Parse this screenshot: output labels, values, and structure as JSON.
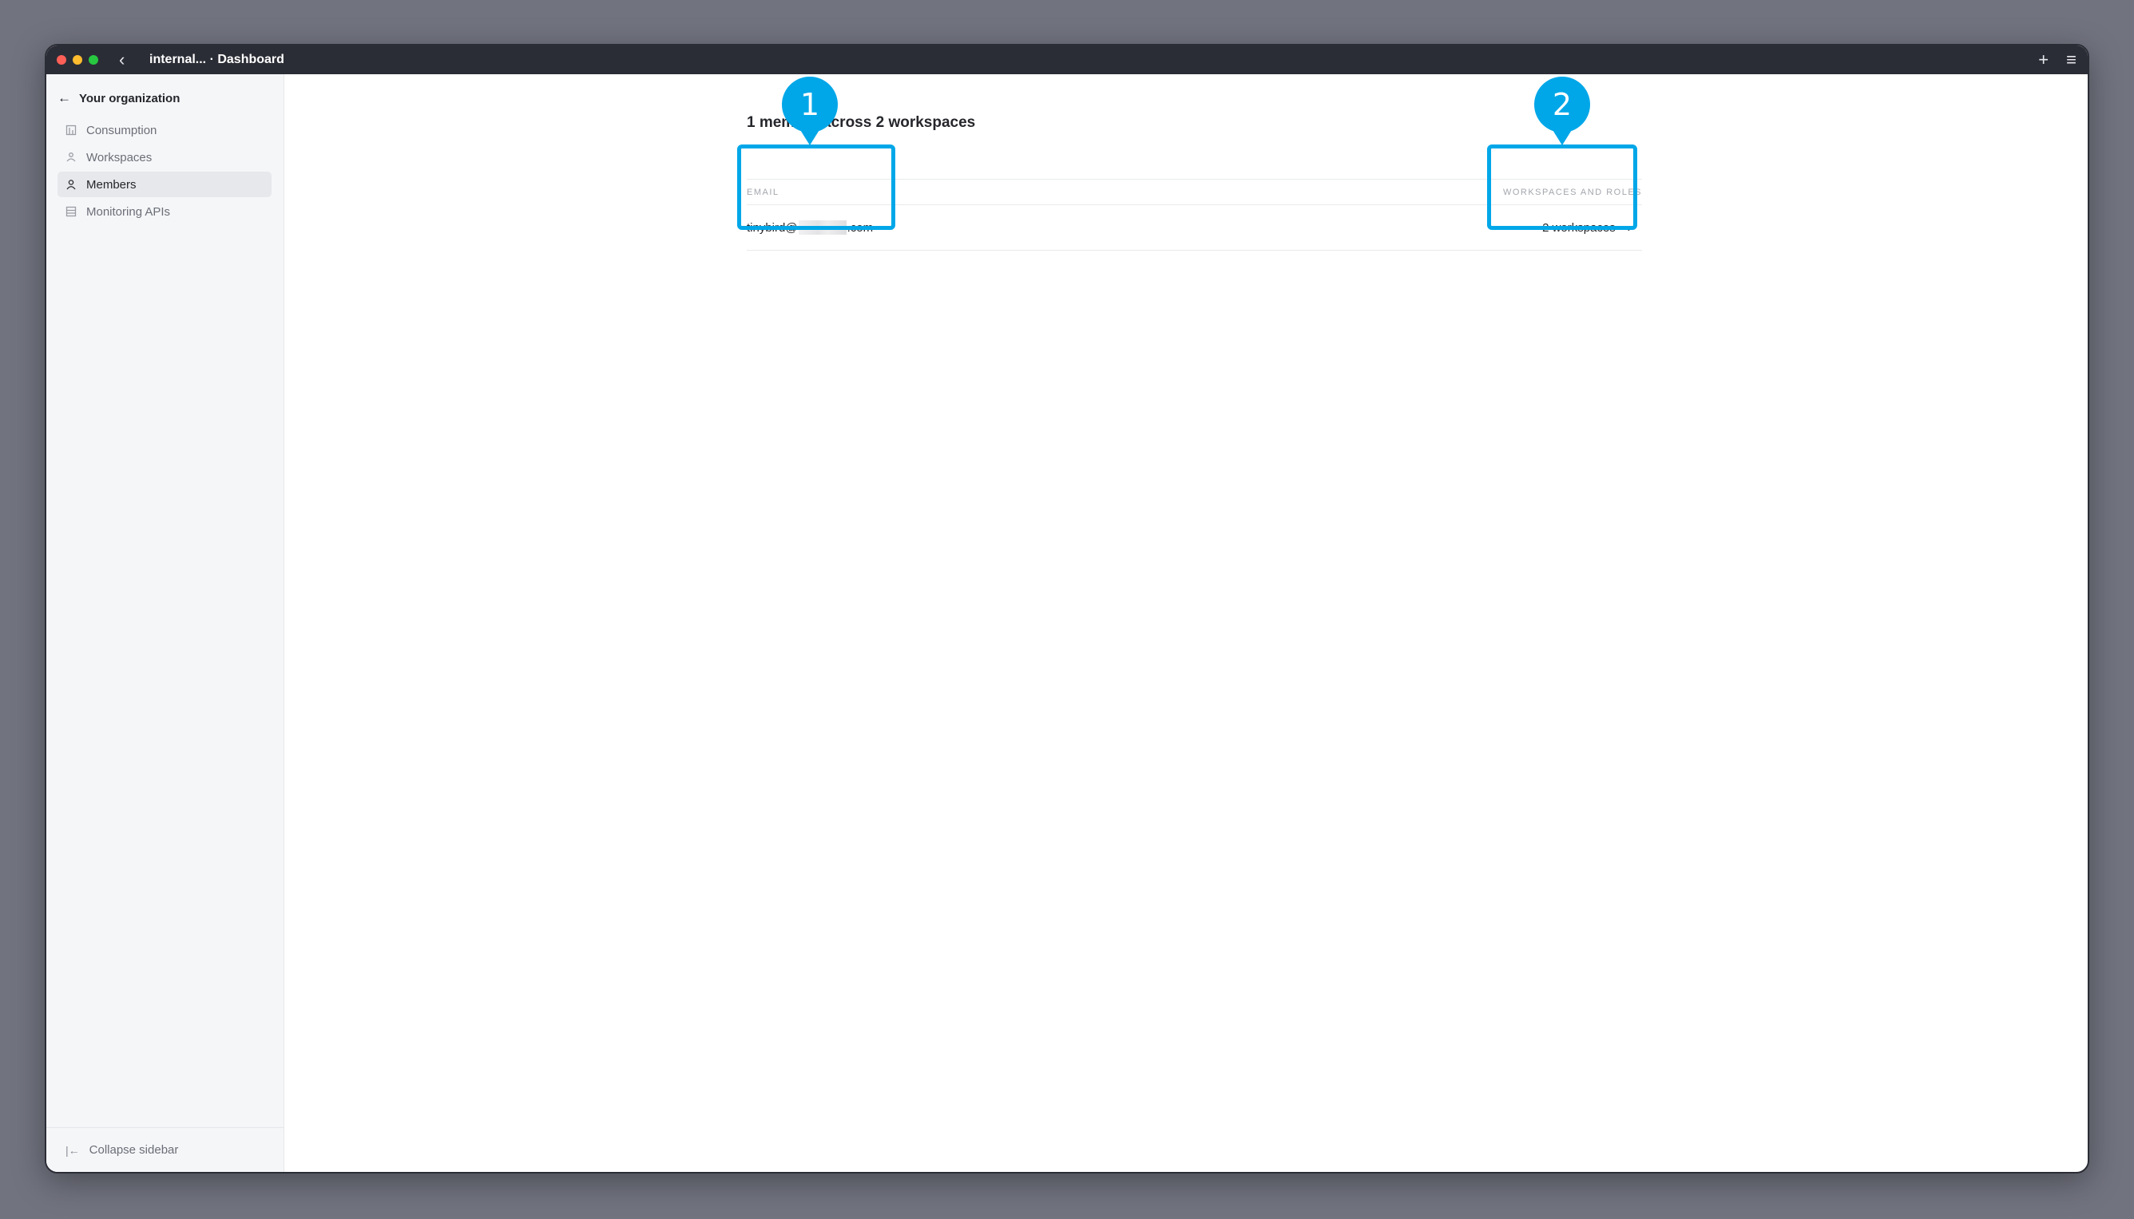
{
  "window": {
    "title": "internal... · Dashboard"
  },
  "sidebar": {
    "back_label": "Your organization",
    "items": [
      {
        "label": "Consumption",
        "icon": "consumption-icon",
        "active": false
      },
      {
        "label": "Workspaces",
        "icon": "workspaces-icon",
        "active": false
      },
      {
        "label": "Members",
        "icon": "user-icon",
        "active": true
      },
      {
        "label": "Monitoring APIs",
        "icon": "monitoring-icon",
        "active": false
      }
    ],
    "collapse_label": "Collapse sidebar"
  },
  "main": {
    "heading": "1 member across 2 workspaces",
    "columns": {
      "email": "EMAIL",
      "workspaces": "WORKSPACES AND ROLES"
    },
    "rows": [
      {
        "email_prefix": "tinybird@",
        "email_suffix": ".com",
        "workspaces": "2 workspaces"
      }
    ]
  },
  "callouts": [
    {
      "number": "1"
    },
    {
      "number": "2"
    }
  ],
  "colors": {
    "accent": "#00a7e8",
    "titlebar": "#2b2d36",
    "sidebar_bg": "#f5f6f8",
    "desktop_bg": "#71737f"
  }
}
